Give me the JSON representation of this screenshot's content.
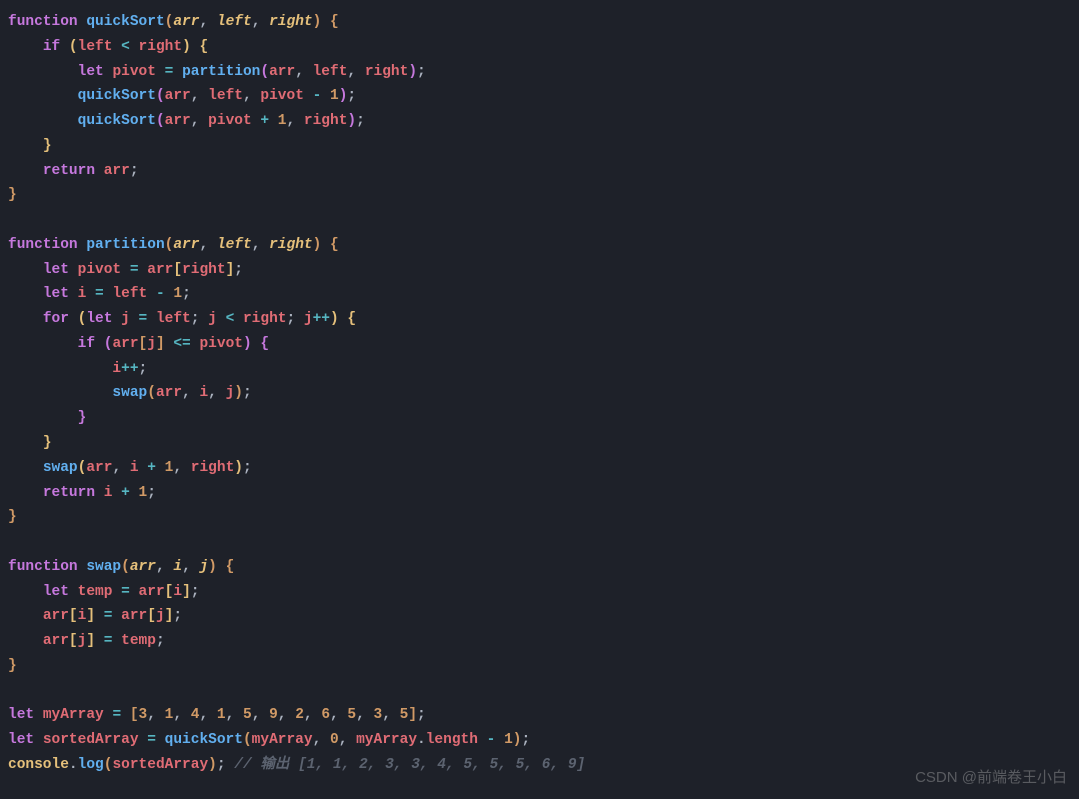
{
  "lines": [
    [
      {
        "cls": "kw",
        "t": "function "
      },
      {
        "cls": "fn",
        "t": "quickSort"
      },
      {
        "cls": "brace",
        "t": "("
      },
      {
        "cls": "param",
        "t": "arr"
      },
      {
        "cls": "punct",
        "t": ", "
      },
      {
        "cls": "param",
        "t": "left"
      },
      {
        "cls": "punct",
        "t": ", "
      },
      {
        "cls": "param",
        "t": "right"
      },
      {
        "cls": "brace",
        "t": ")"
      },
      {
        "cls": "punct",
        "t": " "
      },
      {
        "cls": "brace",
        "t": "{"
      }
    ],
    [
      {
        "cls": "punct",
        "t": "    "
      },
      {
        "cls": "kw",
        "t": "if"
      },
      {
        "cls": "punct",
        "t": " "
      },
      {
        "cls": "brace-y",
        "t": "("
      },
      {
        "cls": "variable",
        "t": "left"
      },
      {
        "cls": "punct",
        "t": " "
      },
      {
        "cls": "op",
        "t": "<"
      },
      {
        "cls": "punct",
        "t": " "
      },
      {
        "cls": "variable",
        "t": "right"
      },
      {
        "cls": "brace-y",
        "t": ")"
      },
      {
        "cls": "punct",
        "t": " "
      },
      {
        "cls": "brace-y",
        "t": "{"
      }
    ],
    [
      {
        "cls": "punct",
        "t": "        "
      },
      {
        "cls": "kw",
        "t": "let"
      },
      {
        "cls": "punct",
        "t": " "
      },
      {
        "cls": "variable",
        "t": "pivot"
      },
      {
        "cls": "punct",
        "t": " "
      },
      {
        "cls": "op",
        "t": "="
      },
      {
        "cls": "punct",
        "t": " "
      },
      {
        "cls": "fn",
        "t": "partition"
      },
      {
        "cls": "brace-p",
        "t": "("
      },
      {
        "cls": "variable",
        "t": "arr"
      },
      {
        "cls": "punct",
        "t": ", "
      },
      {
        "cls": "variable",
        "t": "left"
      },
      {
        "cls": "punct",
        "t": ", "
      },
      {
        "cls": "variable",
        "t": "right"
      },
      {
        "cls": "brace-p",
        "t": ")"
      },
      {
        "cls": "punct",
        "t": ";"
      }
    ],
    [
      {
        "cls": "punct",
        "t": "        "
      },
      {
        "cls": "fn",
        "t": "quickSort"
      },
      {
        "cls": "brace-p",
        "t": "("
      },
      {
        "cls": "variable",
        "t": "arr"
      },
      {
        "cls": "punct",
        "t": ", "
      },
      {
        "cls": "variable",
        "t": "left"
      },
      {
        "cls": "punct",
        "t": ", "
      },
      {
        "cls": "variable",
        "t": "pivot"
      },
      {
        "cls": "punct",
        "t": " "
      },
      {
        "cls": "op",
        "t": "-"
      },
      {
        "cls": "punct",
        "t": " "
      },
      {
        "cls": "num",
        "t": "1"
      },
      {
        "cls": "brace-p",
        "t": ")"
      },
      {
        "cls": "punct",
        "t": ";"
      }
    ],
    [
      {
        "cls": "punct",
        "t": "        "
      },
      {
        "cls": "fn",
        "t": "quickSort"
      },
      {
        "cls": "brace-p",
        "t": "("
      },
      {
        "cls": "variable",
        "t": "arr"
      },
      {
        "cls": "punct",
        "t": ", "
      },
      {
        "cls": "variable",
        "t": "pivot"
      },
      {
        "cls": "punct",
        "t": " "
      },
      {
        "cls": "op",
        "t": "+"
      },
      {
        "cls": "punct",
        "t": " "
      },
      {
        "cls": "num",
        "t": "1"
      },
      {
        "cls": "punct",
        "t": ", "
      },
      {
        "cls": "variable",
        "t": "right"
      },
      {
        "cls": "brace-p",
        "t": ")"
      },
      {
        "cls": "punct",
        "t": ";"
      }
    ],
    [
      {
        "cls": "punct",
        "t": "    "
      },
      {
        "cls": "brace-y",
        "t": "}"
      }
    ],
    [
      {
        "cls": "punct",
        "t": "    "
      },
      {
        "cls": "kw",
        "t": "return"
      },
      {
        "cls": "punct",
        "t": " "
      },
      {
        "cls": "variable",
        "t": "arr"
      },
      {
        "cls": "punct",
        "t": ";"
      }
    ],
    [
      {
        "cls": "brace",
        "t": "}"
      }
    ],
    [
      {
        "cls": "punct",
        "t": ""
      }
    ],
    [
      {
        "cls": "kw",
        "t": "function "
      },
      {
        "cls": "fn",
        "t": "partition"
      },
      {
        "cls": "brace",
        "t": "("
      },
      {
        "cls": "param",
        "t": "arr"
      },
      {
        "cls": "punct",
        "t": ", "
      },
      {
        "cls": "param",
        "t": "left"
      },
      {
        "cls": "punct",
        "t": ", "
      },
      {
        "cls": "param",
        "t": "right"
      },
      {
        "cls": "brace",
        "t": ")"
      },
      {
        "cls": "punct",
        "t": " "
      },
      {
        "cls": "brace",
        "t": "{"
      }
    ],
    [
      {
        "cls": "punct",
        "t": "    "
      },
      {
        "cls": "kw",
        "t": "let"
      },
      {
        "cls": "punct",
        "t": " "
      },
      {
        "cls": "variable",
        "t": "pivot"
      },
      {
        "cls": "punct",
        "t": " "
      },
      {
        "cls": "op",
        "t": "="
      },
      {
        "cls": "punct",
        "t": " "
      },
      {
        "cls": "variable",
        "t": "arr"
      },
      {
        "cls": "brace-y",
        "t": "["
      },
      {
        "cls": "variable",
        "t": "right"
      },
      {
        "cls": "brace-y",
        "t": "]"
      },
      {
        "cls": "punct",
        "t": ";"
      }
    ],
    [
      {
        "cls": "punct",
        "t": "    "
      },
      {
        "cls": "kw",
        "t": "let"
      },
      {
        "cls": "punct",
        "t": " "
      },
      {
        "cls": "variable",
        "t": "i"
      },
      {
        "cls": "punct",
        "t": " "
      },
      {
        "cls": "op",
        "t": "="
      },
      {
        "cls": "punct",
        "t": " "
      },
      {
        "cls": "variable",
        "t": "left"
      },
      {
        "cls": "punct",
        "t": " "
      },
      {
        "cls": "op",
        "t": "-"
      },
      {
        "cls": "punct",
        "t": " "
      },
      {
        "cls": "num",
        "t": "1"
      },
      {
        "cls": "punct",
        "t": ";"
      }
    ],
    [
      {
        "cls": "punct",
        "t": "    "
      },
      {
        "cls": "kw",
        "t": "for"
      },
      {
        "cls": "punct",
        "t": " "
      },
      {
        "cls": "brace-y",
        "t": "("
      },
      {
        "cls": "kw",
        "t": "let"
      },
      {
        "cls": "punct",
        "t": " "
      },
      {
        "cls": "variable",
        "t": "j"
      },
      {
        "cls": "punct",
        "t": " "
      },
      {
        "cls": "op",
        "t": "="
      },
      {
        "cls": "punct",
        "t": " "
      },
      {
        "cls": "variable",
        "t": "left"
      },
      {
        "cls": "punct",
        "t": "; "
      },
      {
        "cls": "variable",
        "t": "j"
      },
      {
        "cls": "punct",
        "t": " "
      },
      {
        "cls": "op",
        "t": "<"
      },
      {
        "cls": "punct",
        "t": " "
      },
      {
        "cls": "variable",
        "t": "right"
      },
      {
        "cls": "punct",
        "t": "; "
      },
      {
        "cls": "variable",
        "t": "j"
      },
      {
        "cls": "op",
        "t": "++"
      },
      {
        "cls": "brace-y",
        "t": ")"
      },
      {
        "cls": "punct",
        "t": " "
      },
      {
        "cls": "brace-y",
        "t": "{"
      }
    ],
    [
      {
        "cls": "punct",
        "t": "        "
      },
      {
        "cls": "kw",
        "t": "if"
      },
      {
        "cls": "punct",
        "t": " "
      },
      {
        "cls": "brace-p",
        "t": "("
      },
      {
        "cls": "variable",
        "t": "arr"
      },
      {
        "cls": "brace",
        "t": "["
      },
      {
        "cls": "variable",
        "t": "j"
      },
      {
        "cls": "brace",
        "t": "]"
      },
      {
        "cls": "punct",
        "t": " "
      },
      {
        "cls": "op",
        "t": "<="
      },
      {
        "cls": "punct",
        "t": " "
      },
      {
        "cls": "variable",
        "t": "pivot"
      },
      {
        "cls": "brace-p",
        "t": ")"
      },
      {
        "cls": "punct",
        "t": " "
      },
      {
        "cls": "brace-p",
        "t": "{"
      }
    ],
    [
      {
        "cls": "punct",
        "t": "            "
      },
      {
        "cls": "variable",
        "t": "i"
      },
      {
        "cls": "op",
        "t": "++"
      },
      {
        "cls": "punct",
        "t": ";"
      }
    ],
    [
      {
        "cls": "punct",
        "t": "            "
      },
      {
        "cls": "fn",
        "t": "swap"
      },
      {
        "cls": "brace",
        "t": "("
      },
      {
        "cls": "variable",
        "t": "arr"
      },
      {
        "cls": "punct",
        "t": ", "
      },
      {
        "cls": "variable",
        "t": "i"
      },
      {
        "cls": "punct",
        "t": ", "
      },
      {
        "cls": "variable",
        "t": "j"
      },
      {
        "cls": "brace",
        "t": ")"
      },
      {
        "cls": "punct",
        "t": ";"
      }
    ],
    [
      {
        "cls": "punct",
        "t": "        "
      },
      {
        "cls": "brace-p",
        "t": "}"
      }
    ],
    [
      {
        "cls": "punct",
        "t": "    "
      },
      {
        "cls": "brace-y",
        "t": "}"
      }
    ],
    [
      {
        "cls": "punct",
        "t": "    "
      },
      {
        "cls": "fn",
        "t": "swap"
      },
      {
        "cls": "brace-y",
        "t": "("
      },
      {
        "cls": "variable",
        "t": "arr"
      },
      {
        "cls": "punct",
        "t": ", "
      },
      {
        "cls": "variable",
        "t": "i"
      },
      {
        "cls": "punct",
        "t": " "
      },
      {
        "cls": "op",
        "t": "+"
      },
      {
        "cls": "punct",
        "t": " "
      },
      {
        "cls": "num",
        "t": "1"
      },
      {
        "cls": "punct",
        "t": ", "
      },
      {
        "cls": "variable",
        "t": "right"
      },
      {
        "cls": "brace-y",
        "t": ")"
      },
      {
        "cls": "punct",
        "t": ";"
      }
    ],
    [
      {
        "cls": "punct",
        "t": "    "
      },
      {
        "cls": "kw",
        "t": "return"
      },
      {
        "cls": "punct",
        "t": " "
      },
      {
        "cls": "variable",
        "t": "i"
      },
      {
        "cls": "punct",
        "t": " "
      },
      {
        "cls": "op",
        "t": "+"
      },
      {
        "cls": "punct",
        "t": " "
      },
      {
        "cls": "num",
        "t": "1"
      },
      {
        "cls": "punct",
        "t": ";"
      }
    ],
    [
      {
        "cls": "brace",
        "t": "}"
      }
    ],
    [
      {
        "cls": "punct",
        "t": ""
      }
    ],
    [
      {
        "cls": "kw",
        "t": "function "
      },
      {
        "cls": "fn",
        "t": "swap"
      },
      {
        "cls": "brace",
        "t": "("
      },
      {
        "cls": "param",
        "t": "arr"
      },
      {
        "cls": "punct",
        "t": ", "
      },
      {
        "cls": "param",
        "t": "i"
      },
      {
        "cls": "punct",
        "t": ", "
      },
      {
        "cls": "param",
        "t": "j"
      },
      {
        "cls": "brace",
        "t": ")"
      },
      {
        "cls": "punct",
        "t": " "
      },
      {
        "cls": "brace",
        "t": "{"
      }
    ],
    [
      {
        "cls": "punct",
        "t": "    "
      },
      {
        "cls": "kw",
        "t": "let"
      },
      {
        "cls": "punct",
        "t": " "
      },
      {
        "cls": "variable",
        "t": "temp"
      },
      {
        "cls": "punct",
        "t": " "
      },
      {
        "cls": "op",
        "t": "="
      },
      {
        "cls": "punct",
        "t": " "
      },
      {
        "cls": "variable",
        "t": "arr"
      },
      {
        "cls": "brace-y",
        "t": "["
      },
      {
        "cls": "variable",
        "t": "i"
      },
      {
        "cls": "brace-y",
        "t": "]"
      },
      {
        "cls": "punct",
        "t": ";"
      }
    ],
    [
      {
        "cls": "punct",
        "t": "    "
      },
      {
        "cls": "variable",
        "t": "arr"
      },
      {
        "cls": "brace-y",
        "t": "["
      },
      {
        "cls": "variable",
        "t": "i"
      },
      {
        "cls": "brace-y",
        "t": "]"
      },
      {
        "cls": "punct",
        "t": " "
      },
      {
        "cls": "op",
        "t": "="
      },
      {
        "cls": "punct",
        "t": " "
      },
      {
        "cls": "variable",
        "t": "arr"
      },
      {
        "cls": "brace-y",
        "t": "["
      },
      {
        "cls": "variable",
        "t": "j"
      },
      {
        "cls": "brace-y",
        "t": "]"
      },
      {
        "cls": "punct",
        "t": ";"
      }
    ],
    [
      {
        "cls": "punct",
        "t": "    "
      },
      {
        "cls": "variable",
        "t": "arr"
      },
      {
        "cls": "brace-y",
        "t": "["
      },
      {
        "cls": "variable",
        "t": "j"
      },
      {
        "cls": "brace-y",
        "t": "]"
      },
      {
        "cls": "punct",
        "t": " "
      },
      {
        "cls": "op",
        "t": "="
      },
      {
        "cls": "punct",
        "t": " "
      },
      {
        "cls": "variable",
        "t": "temp"
      },
      {
        "cls": "punct",
        "t": ";"
      }
    ],
    [
      {
        "cls": "brace",
        "t": "}"
      }
    ],
    [
      {
        "cls": "punct",
        "t": ""
      }
    ],
    [
      {
        "cls": "kw",
        "t": "let"
      },
      {
        "cls": "punct",
        "t": " "
      },
      {
        "cls": "variable",
        "t": "myArray"
      },
      {
        "cls": "punct",
        "t": " "
      },
      {
        "cls": "op",
        "t": "="
      },
      {
        "cls": "punct",
        "t": " "
      },
      {
        "cls": "brace",
        "t": "["
      },
      {
        "cls": "num",
        "t": "3"
      },
      {
        "cls": "punct",
        "t": ", "
      },
      {
        "cls": "num",
        "t": "1"
      },
      {
        "cls": "punct",
        "t": ", "
      },
      {
        "cls": "num",
        "t": "4"
      },
      {
        "cls": "punct",
        "t": ", "
      },
      {
        "cls": "num",
        "t": "1"
      },
      {
        "cls": "punct",
        "t": ", "
      },
      {
        "cls": "num",
        "t": "5"
      },
      {
        "cls": "punct",
        "t": ", "
      },
      {
        "cls": "num",
        "t": "9"
      },
      {
        "cls": "punct",
        "t": ", "
      },
      {
        "cls": "num",
        "t": "2"
      },
      {
        "cls": "punct",
        "t": ", "
      },
      {
        "cls": "num",
        "t": "6"
      },
      {
        "cls": "punct",
        "t": ", "
      },
      {
        "cls": "num",
        "t": "5"
      },
      {
        "cls": "punct",
        "t": ", "
      },
      {
        "cls": "num",
        "t": "3"
      },
      {
        "cls": "punct",
        "t": ", "
      },
      {
        "cls": "num",
        "t": "5"
      },
      {
        "cls": "brace",
        "t": "]"
      },
      {
        "cls": "punct",
        "t": ";"
      }
    ],
    [
      {
        "cls": "kw",
        "t": "let"
      },
      {
        "cls": "punct",
        "t": " "
      },
      {
        "cls": "variable",
        "t": "sortedArray"
      },
      {
        "cls": "punct",
        "t": " "
      },
      {
        "cls": "op",
        "t": "="
      },
      {
        "cls": "punct",
        "t": " "
      },
      {
        "cls": "fn",
        "t": "quickSort"
      },
      {
        "cls": "brace",
        "t": "("
      },
      {
        "cls": "variable",
        "t": "myArray"
      },
      {
        "cls": "punct",
        "t": ", "
      },
      {
        "cls": "num",
        "t": "0"
      },
      {
        "cls": "punct",
        "t": ", "
      },
      {
        "cls": "variable",
        "t": "myArray"
      },
      {
        "cls": "punct",
        "t": "."
      },
      {
        "cls": "prop",
        "t": "length"
      },
      {
        "cls": "punct",
        "t": " "
      },
      {
        "cls": "op",
        "t": "-"
      },
      {
        "cls": "punct",
        "t": " "
      },
      {
        "cls": "num",
        "t": "1"
      },
      {
        "cls": "brace",
        "t": ")"
      },
      {
        "cls": "punct",
        "t": ";"
      }
    ],
    [
      {
        "cls": "obj",
        "t": "console"
      },
      {
        "cls": "punct",
        "t": "."
      },
      {
        "cls": "fn",
        "t": "log"
      },
      {
        "cls": "brace",
        "t": "("
      },
      {
        "cls": "variable",
        "t": "sortedArray"
      },
      {
        "cls": "brace",
        "t": ")"
      },
      {
        "cls": "punct",
        "t": "; "
      },
      {
        "cls": "comment",
        "t": "// 输出 [1, 1, 2, 3, 3, 4, 5, 5, 5, 6, 9]"
      }
    ]
  ],
  "watermark": "CSDN @前端卷王小白"
}
